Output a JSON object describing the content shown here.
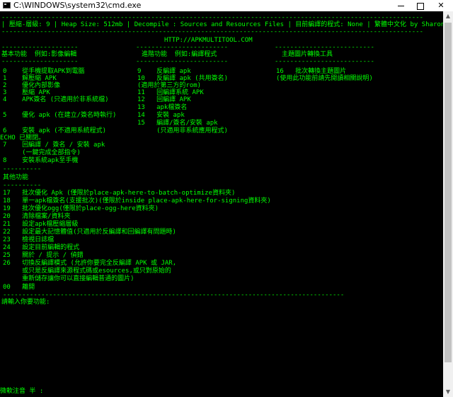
{
  "window": {
    "title": "C:\\WINDOWS\\system32\\cmd.exe",
    "app_icon": "console-icon",
    "minimize_icon": "minimize-icon",
    "maximize_icon": "maximize-icon",
    "close_label": "✕"
  },
  "console": {
    "header": {
      "rule_top": "--------------------------------------------------------------------------------------------------------------",
      "status": "| 壓縮-層級: 9 | Heap Size: 512mb | Decompile : Sources and Resources Files | 目前編譯的程式: None | 繁體中文化 by Sharonlin",
      "rule_mid": "--------------------------------------------------------------------------------------------------------------",
      "url": "HTTP://APKMULTITOOL.COM"
    },
    "sections": {
      "basic": {
        "rule": "--------------------",
        "title": "基本功能  例如:影像編輯",
        "rule2": "--------------------"
      },
      "advanced": {
        "rule": "------------------------",
        "title": "進階功能  例如:編譯程式",
        "rule2": "------------------------"
      },
      "theme": {
        "rule": "--------------------------",
        "title": "主題圖片轉換工具",
        "rule2": "--------------------------"
      }
    },
    "basic_items": [
      "0    從手機提取APK到電腦",
      "1    解壓縮 APK",
      "2    優化內部影像",
      "3    壓縮 APK",
      "4    APK簽名 (只適用於非系統檔)",
      "5    優化 apk (在建立/簽名時執行)",
      "6    安裝 apk (不適用系統程式)",
      "ECHO 已關閉。",
      "7    回編譯 / 簽名 / 安裝 apk",
      "     (一鍵完成全部指令)",
      "8    安裝系統apk至手機"
    ],
    "advanced_items": [
      "9    反編譯 apk",
      "10   反編譯 apk (共用簽名)",
      "(適用於第三方的rom)",
      "11   回編譯系統 APK",
      "12   回編譯 APK",
      "13   apk檔簽名",
      "14   安裝 apk",
      "15   編譯/簽名/安裝 apk",
      "     (只適用非系統應用程式)"
    ],
    "theme_items": [
      "16   批次轉換主題圖片",
      "(使用此功能前請先閱讀相關說明)"
    ],
    "other": {
      "rule": "----------",
      "title": "其他功能",
      "rule2": "----------",
      "items": [
        "17   批次優化 Apk (僅限於place-apk-here-to-batch-optimize資料夾)",
        "18   單一apk檔簽名(支援批次)(僅限於inside place-apk-here-for-signing資料夾)",
        "19   批次優化ogg(僅限於place-ogg-here資料夾)",
        "20   清除檔案/資料夾",
        "21   設定apk檔壓縮層級",
        "22   設定最大記憶體值(只適用於反編譯和回編譯有問題時)",
        "23   檢視日誌檔",
        "24   設定目前編輯的程式",
        "25   關於 / 提示 / 偵錯",
        "26   切換反編譯模式 (允許你要完全反編譯 APK 或 JAR,",
        "     或只是反編譯來源程式碼或esources,或只對原始的",
        "     重新儲存讓你可以直接編輯普通的圖片)",
        "00   離開"
      ],
      "rule_end": "-----------------------------------------------------------------------------------------"
    },
    "prompt": "請輸入你要功能:",
    "ime_status": "微軟注音 半 :"
  }
}
